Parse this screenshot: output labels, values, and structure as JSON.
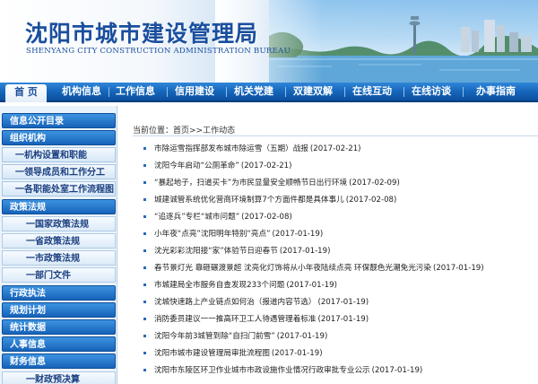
{
  "header": {
    "title": "沈阳市城市建设管理局",
    "subtitle": "SHENYANG CITY CONSTRUCTION ADMINISTRATION BUREAU"
  },
  "nav": {
    "items": [
      "首 页",
      "机构信息",
      "工作信息",
      "信用建设",
      "机关党建",
      "双建双解",
      "在线互动",
      "在线访谈",
      "办事指南"
    ]
  },
  "sidebar": {
    "items": [
      {
        "label": "信息公开目录",
        "level": "cat"
      },
      {
        "label": "组织机构",
        "level": "cat"
      },
      {
        "label": "一机构设置和职能",
        "level": "sub1"
      },
      {
        "label": "一领导成员和工作分工",
        "level": "sub1"
      },
      {
        "label": "一各职能处室工作流程图",
        "level": "sub1"
      },
      {
        "label": "政策法规",
        "level": "cat"
      },
      {
        "label": "一国家政策法规",
        "level": "sub2"
      },
      {
        "label": "一省政策法规",
        "level": "sub2"
      },
      {
        "label": "一市政策法规",
        "level": "sub2"
      },
      {
        "label": "一部门文件",
        "level": "sub2"
      },
      {
        "label": "行政执法",
        "level": "cat"
      },
      {
        "label": "规划计划",
        "level": "cat"
      },
      {
        "label": "统计数据",
        "level": "cat"
      },
      {
        "label": "人事信息",
        "level": "cat"
      },
      {
        "label": "财务信息",
        "level": "cat"
      },
      {
        "label": "一财政预决算",
        "level": "sub2"
      }
    ]
  },
  "breadcrumb": "当前位置：首页>>工作动态",
  "news": [
    {
      "title": "市除运雪指挥部发布城市除运雪（五期）战报",
      "date": "(2017-02-21)"
    },
    {
      "title": "沈阳今年启动“公厕革命”",
      "date": "(2017-02-21)"
    },
    {
      "title": "“暴起地子，扫道买卡”为市民显量安全顺畅节日出行环境",
      "date": "(2017-02-09)"
    },
    {
      "title": "城建诚管系统优化营商环境制算7个方面件都是具体事儿",
      "date": "(2017-02-08)"
    },
    {
      "title": "“追逐兵”专栏“城市问题”",
      "date": "(2017-02-08)"
    },
    {
      "title": "小年夜“点亮”沈阳明年特别“亮点”",
      "date": "(2017-01-19)"
    },
    {
      "title": "沈光彩彩沈阳接“家”体验节日迎春节",
      "date": "(2017-01-19)"
    },
    {
      "title": "春节景灯光 靠砸碾渡景超 沈亮化灯饰将从小年夜陆续点亮 环保靓色光潮免光污染",
      "date": "(2017-01-19)"
    },
    {
      "title": "市城建局全市服务自查发现233个问题",
      "date": "(2017-01-19)"
    },
    {
      "title": "沈城快速路上产业链点如何治（报道内容节选）",
      "date": "(2017-01-19)"
    },
    {
      "title": "消防委员建议一一推高环卫工人待遇管理着标准",
      "date": "(2017-01-19)"
    },
    {
      "title": "沈阳今年前3城管到除“自扫门前雪”",
      "date": "(2017-01-19)"
    },
    {
      "title": "沈阳市城市建设管理局审批流程图",
      "date": "(2017-01-19)"
    },
    {
      "title": "沈阳市东陵区环卫作业城市市政设施作业情况行政审批专业公示",
      "date": "(2017-01-19)"
    }
  ],
  "colors": {
    "accent": "#1a4f9e",
    "nav": "#1463b8"
  }
}
